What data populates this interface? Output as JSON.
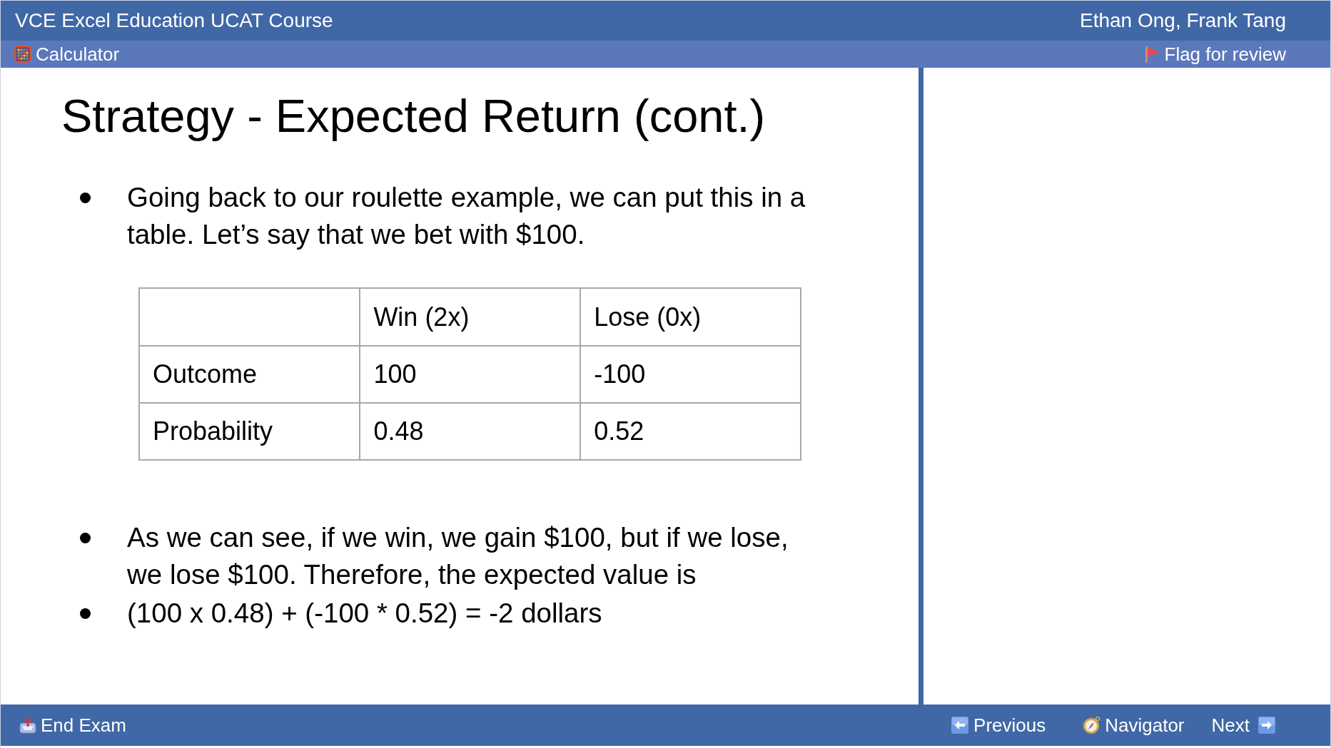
{
  "title_bar": {
    "title": "VCE Excel Education UCAT Course",
    "authors": "Ethan Ong, Frank Tang"
  },
  "toolbar": {
    "calculator": {
      "label": "Calculator"
    },
    "flag": {
      "label": "Flag for review"
    }
  },
  "slide": {
    "title": "Strategy - Expected Return (cont.)",
    "bullets": [
      "Going back to our roulette example, we can put this in a table. Let’s say that we bet with $100."
    ],
    "table": {
      "columns": [
        "Win (2x)",
        "Lose (0x)"
      ],
      "rows": [
        {
          "label": "Outcome",
          "cells": [
            "100",
            "-100"
          ]
        },
        {
          "label": "Probability",
          "cells": [
            "0.48",
            "0.52"
          ]
        }
      ]
    },
    "bullets_after_table": [
      "As we can see, if we win, we gain $100, but if we lose, we lose $100. Therefore, the expected value is",
      "(100 x 0.48) + (-100 * 0.52) = -2 dollars"
    ]
  },
  "footer": {
    "end_exam": {
      "label": "End Exam"
    },
    "previous": {
      "label": "Previous"
    },
    "navigator": {
      "label": "Navigator"
    },
    "next": {
      "label": "Next"
    }
  }
}
